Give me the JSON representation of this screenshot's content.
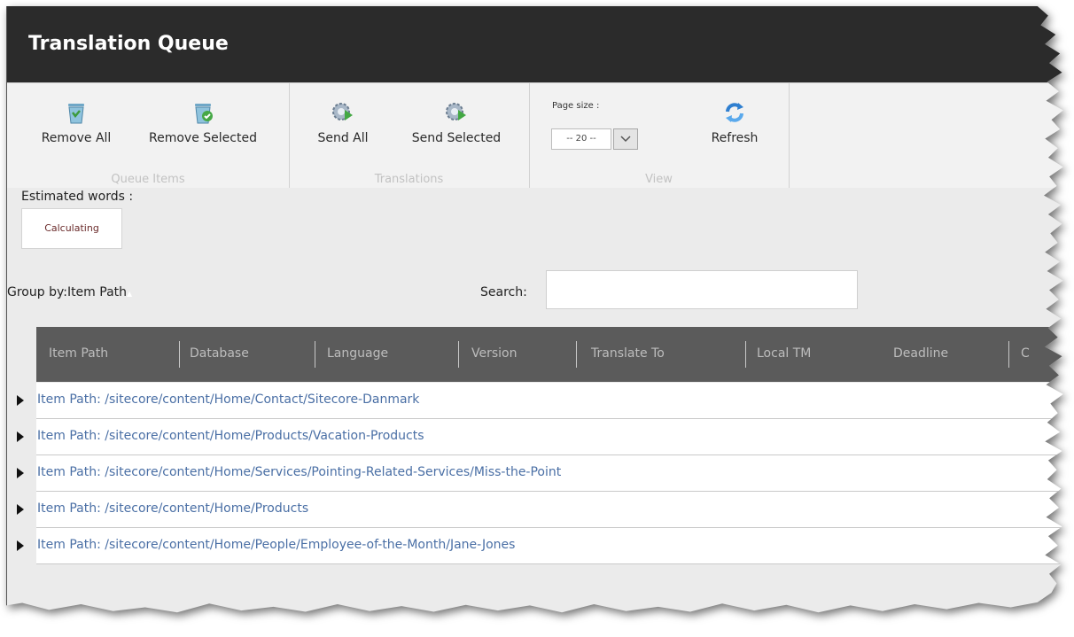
{
  "window": {
    "title": "Translation Queue"
  },
  "ribbon": {
    "groups": [
      {
        "caption": "Queue Items",
        "buttons": [
          {
            "label": "Remove All",
            "icon": "trash-bin-icon"
          },
          {
            "label": "Remove Selected",
            "icon": "trash-check-icon"
          }
        ]
      },
      {
        "caption": "Translations",
        "buttons": [
          {
            "label": "Send All",
            "icon": "gear-send-icon"
          },
          {
            "label": "Send Selected",
            "icon": "gear-send-icon"
          }
        ]
      },
      {
        "caption": "View",
        "pagesize_label": "Page size :",
        "pagesize_value": "-- 20 --",
        "buttons": [
          {
            "label": "Refresh",
            "icon": "refresh-icon"
          }
        ]
      }
    ]
  },
  "estimate": {
    "label": "Estimated words :",
    "value": "Calculating"
  },
  "group_by": {
    "label": "Group by:Item Path"
  },
  "search": {
    "label": "Search:",
    "value": "",
    "placeholder": ""
  },
  "grid": {
    "columns": [
      "Item Path",
      "Database",
      "Language",
      "Version",
      "Translate To",
      "Local TM",
      "Deadline",
      "C"
    ],
    "rows": [
      {
        "text": "Item Path: /sitecore/content/Home/Contact/Sitecore-Danmark"
      },
      {
        "text": "Item Path: /sitecore/content/Home/Products/Vacation-Products"
      },
      {
        "text": "Item Path: /sitecore/content/Home/Services/Pointing-Related-Services/Miss-the-Point"
      },
      {
        "text": "Item Path: /sitecore/content/Home/Products"
      },
      {
        "text": "Item Path: /sitecore/content/Home/People/Employee-of-the-Month/Jane-Jones"
      }
    ]
  },
  "colors": {
    "titlebar": "#2b2b2b",
    "grid_header": "#5b5b5b",
    "link": "#4a6fa5"
  }
}
